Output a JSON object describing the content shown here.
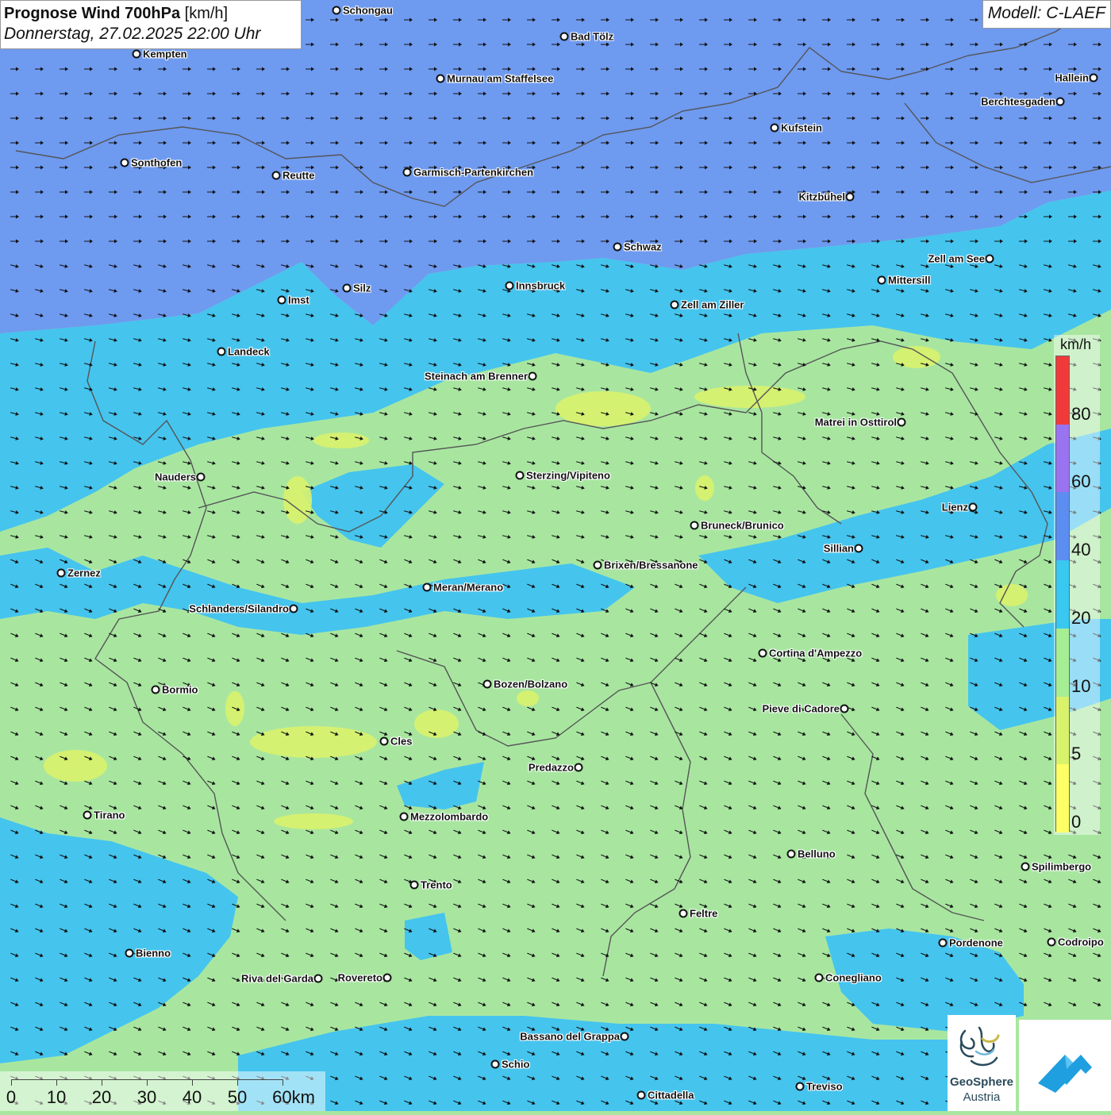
{
  "title": {
    "main_bold": "Prognose Wind 700hPa",
    "main_unit": " [km/h]",
    "date": "Donnerstag, 27.02.2025 22:00 Uhr"
  },
  "model_label": "Modell: C-LAEF",
  "legend": {
    "unit": "km/h",
    "ticks": [
      "0",
      "5",
      "10",
      "20",
      "40",
      "60",
      "80"
    ],
    "colors": [
      "#ffff66",
      "#d9f26b",
      "#a6ee94",
      "#38c8f0",
      "#5b8ef0",
      "#9a73f0",
      "#f03a3a"
    ]
  },
  "colors": {
    "zone_north": "#6e9af0",
    "zone_middle": "#45c4ee",
    "zone_south": "#a8e6a0",
    "patch_yellow": "#d9f26b",
    "arrow": "#111111",
    "border": "#555555"
  },
  "scale_bar": {
    "labels": [
      "0",
      "10",
      "20",
      "30",
      "40",
      "50",
      "60km"
    ]
  },
  "logos": {
    "geosphere_line1": "GeoSphere",
    "geosphere_line2": "Austria"
  },
  "cities": [
    {
      "name": "Schongau"
    },
    {
      "name": "Bad Tölz"
    },
    {
      "name": "Kempten"
    },
    {
      "name": "Murnau am Staffelsee"
    },
    {
      "name": "Hallein"
    },
    {
      "name": "Berchtesgaden"
    },
    {
      "name": "Kufstein"
    },
    {
      "name": "Sonthofen"
    },
    {
      "name": "Reutte"
    },
    {
      "name": "Garmisch-Partenkirchen"
    },
    {
      "name": "Kitzbühel"
    },
    {
      "name": "Schwaz"
    },
    {
      "name": "Zell am See"
    },
    {
      "name": "Mittersill"
    },
    {
      "name": "Imst"
    },
    {
      "name": "Silz"
    },
    {
      "name": "Innsbruck"
    },
    {
      "name": "Zell am Ziller"
    },
    {
      "name": "Landeck"
    },
    {
      "name": "Steinach am Brenner"
    },
    {
      "name": "Matrei in Osttirol"
    },
    {
      "name": "Nauders"
    },
    {
      "name": "Sterzing/Vipiteno"
    },
    {
      "name": "Lienz"
    },
    {
      "name": "Bruneck/Brunico"
    },
    {
      "name": "Sillian"
    },
    {
      "name": "Zernez"
    },
    {
      "name": "Brixen/Bressanone"
    },
    {
      "name": "Meran/Merano"
    },
    {
      "name": "Schlanders/Silandro"
    },
    {
      "name": "Cortina d'Ampezzo"
    },
    {
      "name": "Bozen/Bolzano"
    },
    {
      "name": "Bormio"
    },
    {
      "name": "Pieve di Cadore"
    },
    {
      "name": "Cles"
    },
    {
      "name": "Predazzo"
    },
    {
      "name": "Tirano"
    },
    {
      "name": "Mezzolombardo"
    },
    {
      "name": "Belluno"
    },
    {
      "name": "Spilimbergo"
    },
    {
      "name": "Trento"
    },
    {
      "name": "Feltre"
    },
    {
      "name": "Pordenone"
    },
    {
      "name": "Codroipo"
    },
    {
      "name": "Bienno"
    },
    {
      "name": "Riva del Garda"
    },
    {
      "name": "Rovereto"
    },
    {
      "name": "Conegliano"
    },
    {
      "name": "Bassano del Grappa"
    },
    {
      "name": "Schio"
    },
    {
      "name": "Treviso"
    },
    {
      "name": "Cittadella"
    }
  ]
}
